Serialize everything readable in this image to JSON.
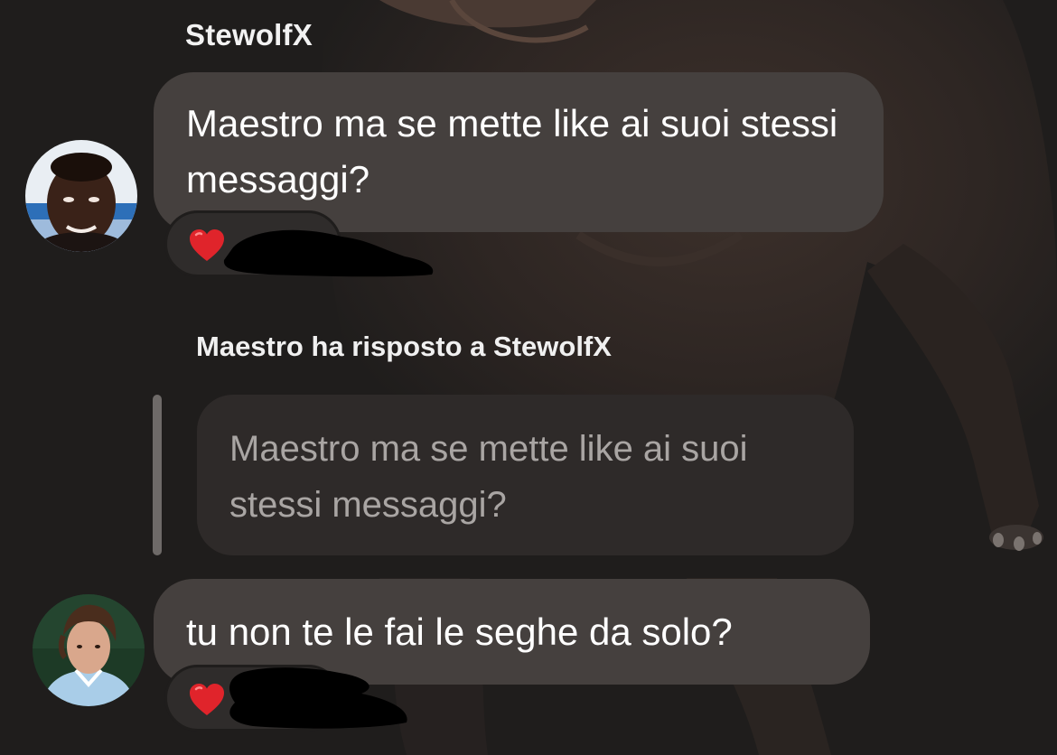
{
  "chat": {
    "message_1": {
      "sender": "StewolfX",
      "text": "Maestro ma se mette like ai suoi stessi messaggi?",
      "reaction": "❤️",
      "reaction_icon": "heart-icon"
    },
    "reply": {
      "header": "Maestro ha risposto a StewolfX",
      "quoted_text": "Maestro ma se mette like ai suoi stessi messaggi?",
      "text": "tu non te le fai le seghe da solo?",
      "reaction": "❤️",
      "reaction_icon": "heart-icon"
    }
  },
  "colors": {
    "background": "#1f1d1c",
    "bubble": "#45403e",
    "quoted_bubble": "#2e2a29",
    "quoted_text": "#a9a5a3",
    "heart": "#e0242b"
  }
}
